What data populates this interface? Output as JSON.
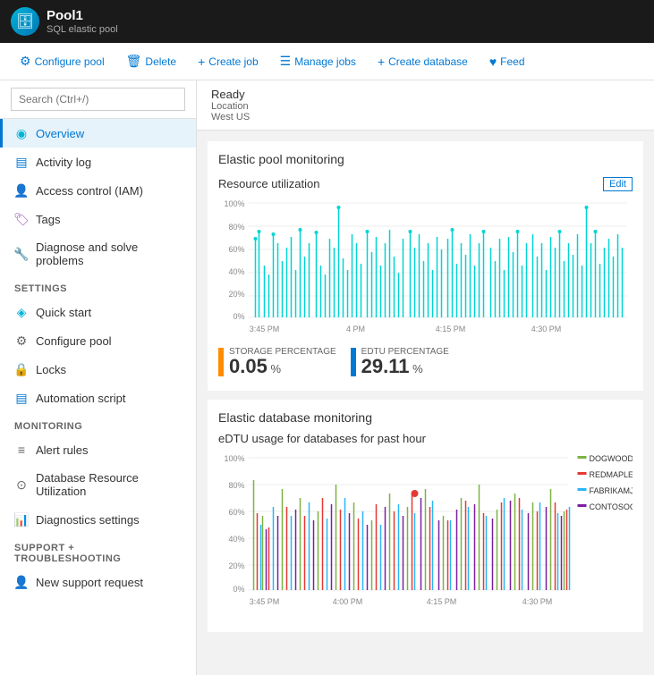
{
  "header": {
    "title": "Pool1",
    "subtitle": "SQL elastic pool",
    "icon": "🗄"
  },
  "toolbar": {
    "buttons": [
      {
        "label": "Configure pool",
        "icon": "⚙",
        "name": "configure-pool-btn"
      },
      {
        "label": "Delete",
        "icon": "🗑",
        "name": "delete-btn"
      },
      {
        "label": "Create job",
        "icon": "+",
        "name": "create-job-btn"
      },
      {
        "label": "Manage jobs",
        "icon": "☰",
        "name": "manage-jobs-btn"
      },
      {
        "label": "Create database",
        "icon": "+",
        "name": "create-database-btn"
      },
      {
        "label": "Feed",
        "icon": "♥",
        "name": "feed-btn"
      }
    ]
  },
  "sidebar": {
    "search_placeholder": "Search (Ctrl+/)",
    "nav_items": [
      {
        "label": "Overview",
        "icon": "◉",
        "active": true,
        "color": "#00b4d8",
        "name": "overview"
      },
      {
        "label": "Activity log",
        "icon": "▤",
        "active": false,
        "color": "#0078d4",
        "name": "activity-log"
      },
      {
        "label": "Access control (IAM)",
        "icon": "👤",
        "active": false,
        "color": "#0078d4",
        "name": "access-control"
      },
      {
        "label": "Tags",
        "icon": "🏷",
        "active": false,
        "color": "#9b59b6",
        "name": "tags"
      },
      {
        "label": "Diagnose and solve problems",
        "icon": "🔧",
        "active": false,
        "color": "#333",
        "name": "diagnose"
      }
    ],
    "sections": [
      {
        "title": "SETTINGS",
        "items": [
          {
            "label": "Quick start",
            "icon": "◈",
            "color": "#00b4d8",
            "name": "quick-start"
          },
          {
            "label": "Configure pool",
            "icon": "⚙",
            "color": "#666",
            "name": "configure-pool-nav"
          },
          {
            "label": "Locks",
            "icon": "🔒",
            "color": "#666",
            "name": "locks"
          },
          {
            "label": "Automation script",
            "icon": "▤",
            "color": "#0078d4",
            "name": "automation-script"
          }
        ]
      },
      {
        "title": "MONITORING",
        "items": [
          {
            "label": "Alert rules",
            "icon": "≡",
            "color": "#666",
            "name": "alert-rules"
          },
          {
            "label": "Database Resource Utilization",
            "icon": "⊙",
            "color": "#666",
            "name": "db-resource-util"
          },
          {
            "label": "Diagnostics settings",
            "icon": "📊",
            "color": "#0078d4",
            "name": "diagnostics-settings"
          }
        ]
      },
      {
        "title": "SUPPORT + TROUBLESHOOTING",
        "items": [
          {
            "label": "New support request",
            "icon": "👤",
            "color": "#0078d4",
            "name": "new-support-request"
          }
        ]
      }
    ]
  },
  "status": {
    "ready": "Ready",
    "location_label": "Location",
    "location_value": "West US"
  },
  "elastic_pool_monitoring": {
    "title": "Elastic pool monitoring",
    "chart_title": "Resource utilization",
    "edit_label": "Edit",
    "time_labels": [
      "3:45 PM",
      "4 PM",
      "4:15 PM",
      "4:30 PM"
    ],
    "y_labels": [
      "100%",
      "80%",
      "60%",
      "40%",
      "20%",
      "0%"
    ],
    "metrics": [
      {
        "label": "STORAGE PERCENTAGE",
        "value": "0.05",
        "unit": "%",
        "color": "#ff8c00"
      },
      {
        "label": "EDTU PERCENTAGE",
        "value": "29.11",
        "unit": "%",
        "color": "#0078d4"
      }
    ]
  },
  "elastic_db_monitoring": {
    "title": "Elastic database monitoring",
    "chart_title": "eDTU usage for databases for past hour",
    "y_labels": [
      "100%",
      "80%",
      "60%",
      "40%",
      "20%",
      "0%"
    ],
    "time_labels": [
      "3:45 PM",
      "4:00 PM",
      "4:15 PM",
      "4:30 PM"
    ],
    "legend": [
      {
        "label": "DOGWOOD...",
        "color": "#7cb342"
      },
      {
        "label": "REDMAPLER...",
        "color": "#e53935"
      },
      {
        "label": "FABRIKAMJA...",
        "color": "#29b6f6"
      },
      {
        "label": "CONTOSOC...",
        "color": "#7b1fa2"
      }
    ]
  }
}
